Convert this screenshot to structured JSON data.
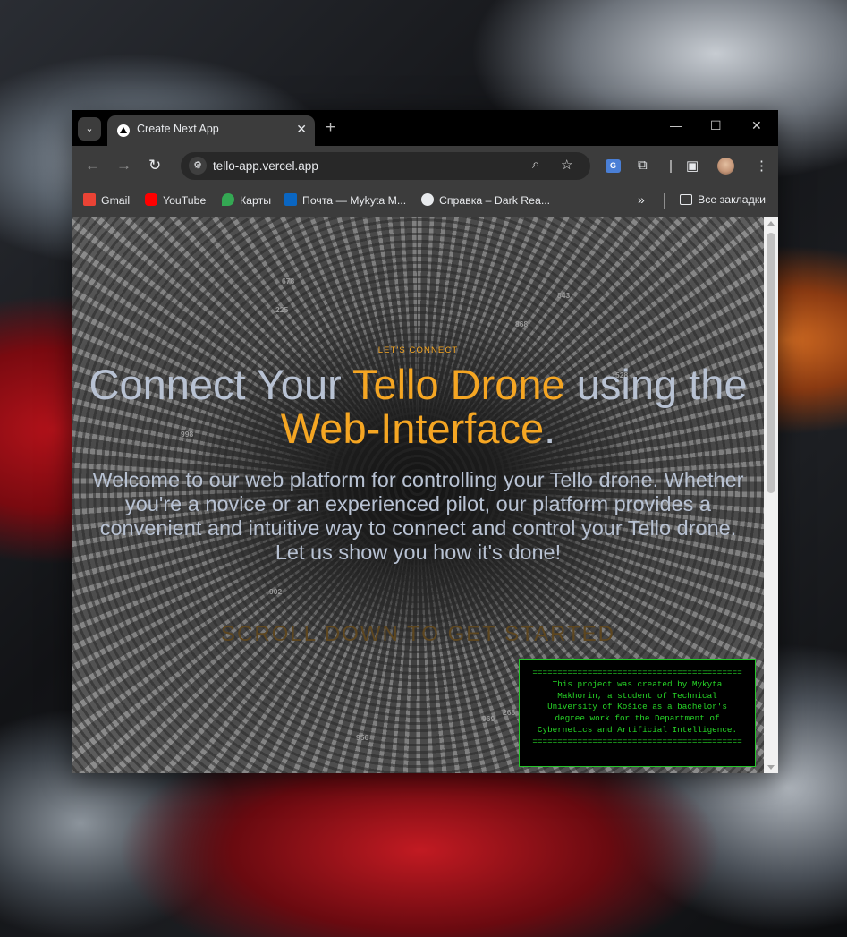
{
  "tab": {
    "title": "Create Next App",
    "close": "✕",
    "new_tab": "+"
  },
  "tab_search": "⌄",
  "window_controls": {
    "minimize": "—",
    "maximize": "☐",
    "close": "✕"
  },
  "toolbar": {
    "back": "←",
    "forward": "→",
    "reload": "↻",
    "url": "tello-app.vercel.app",
    "zoom_icon": "⌕",
    "bookmark_icon": "☆",
    "translate": "G",
    "extensions_icon": "⧉",
    "sidebar_icon": "▣",
    "menu_icon": "⋮",
    "site_info_icon": "⚙"
  },
  "bookmarks": {
    "items": [
      {
        "label": "Gmail",
        "color": "#ea4335"
      },
      {
        "label": "YouTube",
        "color": "#ff0000"
      },
      {
        "label": "Карты",
        "color": "#34a853"
      },
      {
        "label": "Почта — Mykyta M...",
        "color": "#0a66c2"
      },
      {
        "label": "Справка – Dark Rea...",
        "color": "#e8eaed"
      }
    ],
    "more": "»",
    "all_bookmarks": "Все закладки"
  },
  "page": {
    "eyebrow": "LET'S CONNECT",
    "headline": {
      "part1": "Connect Your ",
      "highlight1": "Tello Drone",
      "part2": " using the ",
      "highlight2": "Web-Interface",
      "part3": "."
    },
    "lead": "Welcome to our web platform for controlling your Tello drone. Whether you're a novice or an experienced pilot, our platform provides a convenient and intuitive way to connect and control your Tello drone. Let us show you how it's done!",
    "scroll_cta": "SCROLL DOWN TO GET STARTED",
    "terminal": {
      "rule": "==========================================",
      "text": "This project was created by Mykyta Makhorin, a student of Technical University of Košice as a bachelor's degree work for the Department of Cybernetics and Artificial Intelligence."
    },
    "background_numbers": [
      "678",
      "843",
      "225",
      "868",
      "528",
      "998",
      "902",
      "268",
      "969",
      "956"
    ]
  },
  "colors": {
    "accent": "#f5a623",
    "headline": "#b8c2d3",
    "terminal_green": "#27d627"
  }
}
